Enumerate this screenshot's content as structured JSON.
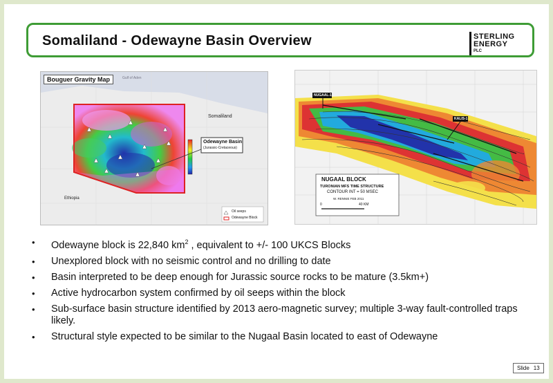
{
  "title": "Somaliland - Odewayne Basin Overview",
  "logo": {
    "line1": "STERLING",
    "line2": "ENERGY",
    "line3": "PLC"
  },
  "gravity_map": {
    "title": "Bouguer Gravity Map",
    "label_gulf": "Gulf of Aden",
    "label_somaliland": "Somaliland",
    "label_ethiopia": "Ethiopia",
    "callout_title": "Odewayne Basin",
    "callout_sub": "(Jurassic-Cretaceous)",
    "legend_seeps": "Oil seeps",
    "legend_block": "Odewayne Block"
  },
  "nugaal_map": {
    "well1": "NUGAAL-1",
    "well2": "KALIS-1",
    "block_title": "NUGAAL BLOCK",
    "structure": "TURONIAN MFS TIME STRUCTURE",
    "contour": "CONTOUR INT = 50 MSEC",
    "author": "W. RENNIE FEB 2011",
    "scale_start": "0",
    "scale_end": "40 KM"
  },
  "bullets": [
    {
      "pre": "Odewayne block is 22,840 km",
      "sup": "2",
      "post": " , equivalent to +/- 100 UKCS Blocks"
    },
    {
      "pre": "Unexplored block with no seismic control and no drilling to date",
      "sup": "",
      "post": ""
    },
    {
      "pre": "Basin interpreted to be deep enough for Jurassic source rocks to be mature (3.5km+)",
      "sup": "",
      "post": ""
    },
    {
      "pre": "Active hydrocarbon system confirmed by oil seeps within the block",
      "sup": "",
      "post": ""
    },
    {
      "pre": "Sub-surface basin structure identified by 2013 aero-magnetic survey; multiple 3-way fault-controlled traps likely.",
      "sup": "",
      "post": ""
    },
    {
      "pre": "Structural style expected to be similar to the Nugaal Basin located to east of Odewayne",
      "sup": "",
      "post": ""
    }
  ],
  "footer": {
    "slide_label": "Slide",
    "slide_number": "13"
  }
}
